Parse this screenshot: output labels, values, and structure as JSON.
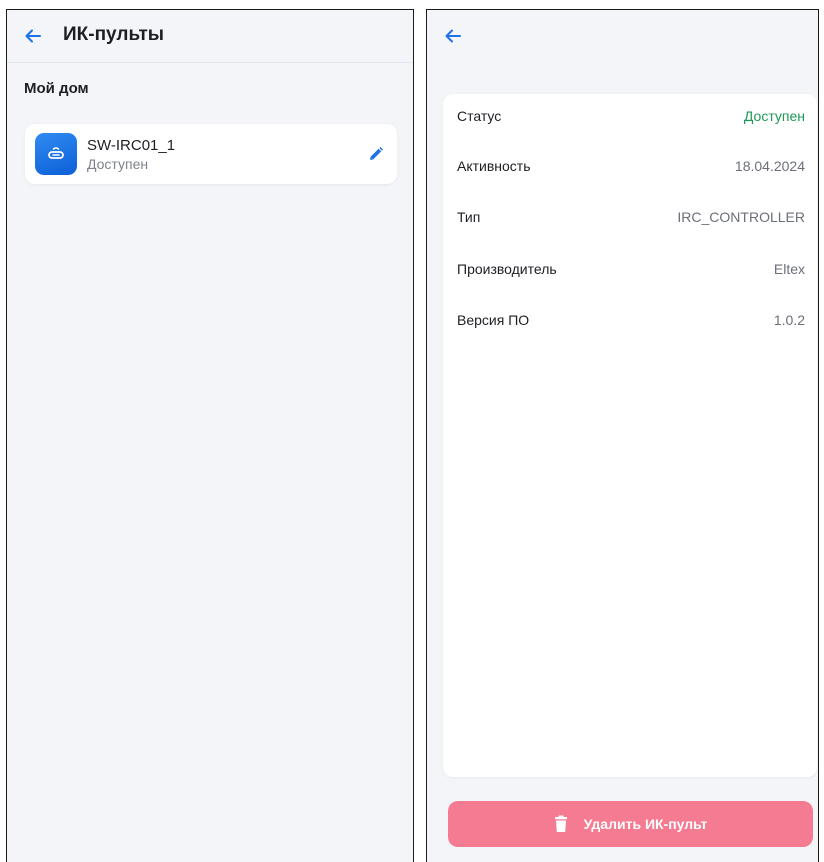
{
  "colors": {
    "accent": "#1e74e6",
    "available": "#1d9a55",
    "danger": "#f47b91",
    "background": "#f3f5f9"
  },
  "list_screen": {
    "title": "ИК-пульты",
    "back_icon": "arrow-left-icon",
    "section_title": "Мой дом",
    "devices": [
      {
        "name": "SW-IRC01_1",
        "status": "Доступен",
        "icon": "ir-remote-icon",
        "action_icon": "pencil-icon"
      }
    ]
  },
  "detail_screen": {
    "back_icon": "arrow-left-icon",
    "rows": [
      {
        "label": "Статус",
        "value": "Доступен"
      },
      {
        "label": "Активность",
        "value": "18.04.2024"
      },
      {
        "label": "Тип",
        "value": "IRC_CONTROLLER"
      },
      {
        "label": "Производитель",
        "value": "Eltex"
      },
      {
        "label": "Версия ПО",
        "value": "1.0.2"
      }
    ],
    "delete_button": {
      "label": "Удалить ИК-пульт",
      "icon": "trash-icon"
    }
  }
}
